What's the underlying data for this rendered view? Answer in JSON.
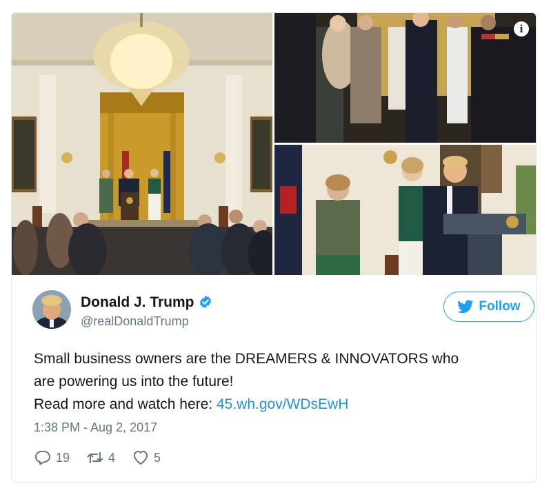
{
  "media": {
    "photos": [
      {
        "icon": "event-photo-wide"
      },
      {
        "icon": "event-photo-audience"
      },
      {
        "icon": "event-photo-podium"
      }
    ],
    "info_icon": "i"
  },
  "author": {
    "display_name": "Donald J. Trump",
    "handle": "@realDonaldTrump",
    "verified": true
  },
  "follow_button": {
    "label": "Follow"
  },
  "tweet": {
    "line1": "Small business owners are the DREAMERS & INNOVATORS who",
    "line2": "are powering us into the future!",
    "line3_prefix": "Read more and watch here: ",
    "link_text": "45.wh.gov/WDsEwH",
    "timestamp": "1:38 PM - Aug 2, 2017"
  },
  "actions": {
    "reply_count": "19",
    "retweet_count": "4",
    "like_count": "5"
  },
  "colors": {
    "accent": "#1da1f2",
    "link": "#1b95e0",
    "muted": "#657786",
    "border": "#e1e8ed"
  }
}
